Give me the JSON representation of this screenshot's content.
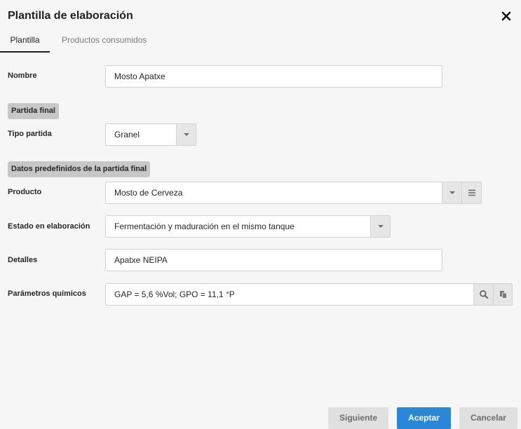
{
  "dialog": {
    "title": "Plantilla de elaboración"
  },
  "tabs": [
    {
      "label": "Plantilla",
      "active": true
    },
    {
      "label": "Productos consumidos",
      "active": false
    }
  ],
  "form": {
    "nombre": {
      "label": "Nombre",
      "value": "Mosto Apatxe"
    },
    "section_partida_final": "Partida final",
    "tipo_partida": {
      "label": "Tipo partida",
      "value": "Granel"
    },
    "section_datos_predefinidos": "Datos predefinidos de la partida final",
    "producto": {
      "label": "Producto",
      "value": "Mosto de Cerveza"
    },
    "estado": {
      "label": "Estado en elaboración",
      "value": "Fermentación y maduración en el mismo tanque"
    },
    "detalles": {
      "label": "Detalles",
      "value": "Apatxe NEIPA"
    },
    "parametros": {
      "label": "Parámetros químicos",
      "value": "GAP = 5,6 %Vol; GPO = 11,1 °P"
    }
  },
  "footer": {
    "next_label": "Siguiente",
    "accept_label": "Aceptar",
    "cancel_label": "Cancelar"
  },
  "icons": {
    "close": "close-icon",
    "dropdown": "chevron-down-icon",
    "menu": "list-icon",
    "search": "search-icon",
    "copy": "copy-icon"
  },
  "colors": {
    "accent": "#2a86d6",
    "background": "#f6f6f6",
    "badge": "#c7c7c7"
  }
}
